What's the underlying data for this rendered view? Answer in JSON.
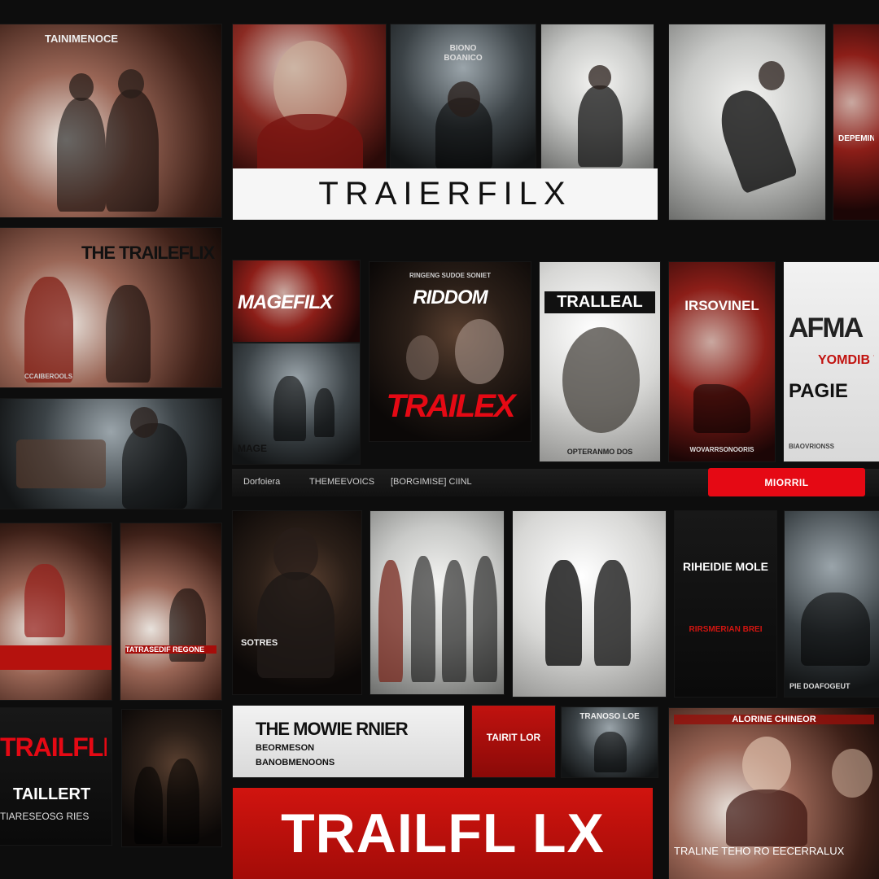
{
  "brand": {
    "top_banner": "TRAIERFILX",
    "bottom_banner": "TRAILFL LX"
  },
  "nav": {
    "items": [
      "Dorfoiera",
      "THEMEEVOICS",
      "[BORGIMISE] CIINL"
    ],
    "button": "MIORRIL"
  },
  "tiles": {
    "t1": "TAINIMENOCE",
    "t2_a": "BIONO",
    "t2_b": "BOANICO",
    "t3": "DEPEMINAS",
    "t4": "THE TRAILEFLIX",
    "t4_sub": "CCAIBEROOLS",
    "t5": "MAGEFILX",
    "t6_title": "RIDDOM",
    "t6_main": "TRAILEX",
    "t6_top": "RINGENG SUDOE SONIET",
    "t7_title": "TRALLEAL",
    "t7_foot": "OPTERANMO DOS",
    "t8_title": "IRSOVINEL",
    "t8_foot": "WOVARRSONOORIS",
    "t9_title": "AFMA",
    "t9_red": "YOMDIB TUEB",
    "t9_page": "PAGIE",
    "t9_foot": "BIAOVRIONSS",
    "t10": "MAGE",
    "t11_foot": "SOTRES",
    "t12": "RIHEIDIE MOLE",
    "t12_sub": "RIRSMERIAN BREI",
    "t13_foot": "PIE DOAFOGEUT",
    "t14": "TATRASEDIF REGONE",
    "t15": "TRAILFLIX",
    "t15_sub": "TAILLERT",
    "t15_sub2": "TIARESEOSG RIES",
    "t16_title": "THE MOWIE RNIER",
    "t16_l1": "BEORMESON",
    "t16_l2": "BANOBMENOONS",
    "t17": "TAIRIT LOR",
    "t18": "TRANOSO LOE",
    "t19_title": "ALORINE CHINEOR",
    "t19_foot": "TRALINE TEHO RO EECERRALUX"
  },
  "colors": {
    "accent": "#e50914",
    "background": "#0d0d0d"
  }
}
